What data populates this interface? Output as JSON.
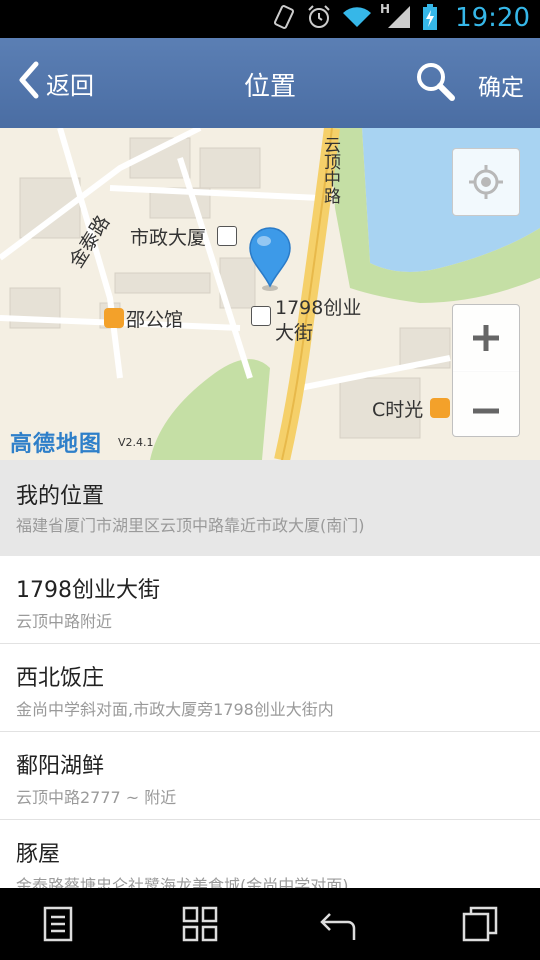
{
  "status_bar": {
    "time": "19:20",
    "icons": [
      "vibrate-icon",
      "alarm-icon",
      "wifi-icon",
      "signal-icon",
      "battery-charging-icon"
    ],
    "signal_label": "H"
  },
  "header": {
    "back_label": "返回",
    "title": "位置",
    "confirm_label": "确定"
  },
  "map": {
    "labels": {
      "road_jintai": "金泰路",
      "road_yunding": "云顶中路",
      "bldg_shizheng": "市政大厦",
      "poi_1798_line1": "1798创业",
      "poi_1798_line2": "大街",
      "poi_shaogongguan": "邵公馆",
      "poi_cshiguang": "C时光"
    },
    "logo": "高德地图",
    "version": "V2.4.1",
    "colors": {
      "land": "#f4efe3",
      "water": "#a8d3f2",
      "green": "#c5dfa5",
      "road_main": "#f5d06a"
    }
  },
  "locations": [
    {
      "name": "我的位置",
      "address": "福建省厦门市湖里区云顶中路靠近市政大厦(南门)",
      "selected": true
    },
    {
      "name": "1798创业大街",
      "address": "云顶中路附近"
    },
    {
      "name": "西北饭庄",
      "address": "金尚中学斜对面,市政大厦旁1798创业大街内"
    },
    {
      "name": "鄱阳湖鲜",
      "address": "云顶中路2777 ~ 附近"
    },
    {
      "name": "豚屋",
      "address": "金泰路蔡塘忠仑社鹭海龙美食城(金尚中学对面)"
    }
  ]
}
